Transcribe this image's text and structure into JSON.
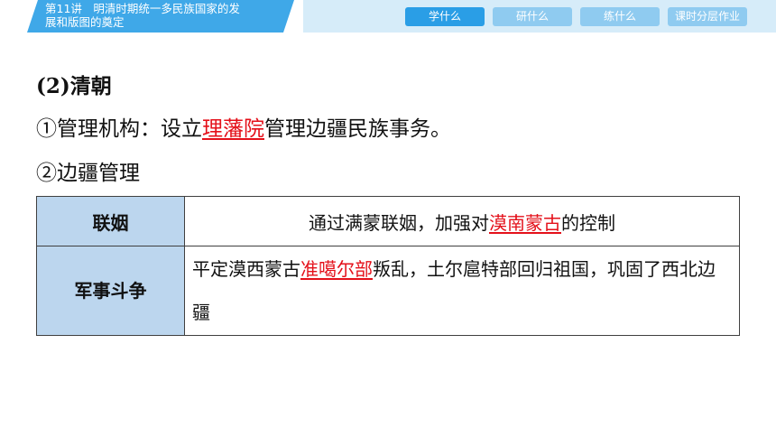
{
  "header": {
    "title": "第11讲　明清时期统一多民族国家的发\n展和版图的奠定",
    "tabs": [
      {
        "label": "学什么",
        "active": true
      },
      {
        "label": "研什么",
        "active": false
      },
      {
        "label": "练什么",
        "active": false
      },
      {
        "label": "课时分层作业",
        "active": false
      }
    ]
  },
  "content": {
    "heading": "(2)清朝",
    "point1": {
      "prefix": "①管理机构：设立",
      "highlight": "理藩院",
      "suffix": "管理边疆民族事务。"
    },
    "point2": "②边疆管理",
    "table": {
      "rows": [
        {
          "label": "联姻",
          "pre": "通过满蒙联姻，加强对",
          "highlight": "漠南蒙古",
          "post": "的控制"
        },
        {
          "label": "军事斗争",
          "pre": "平定漠西蒙古",
          "highlight": "准噶尔部",
          "post": "叛乱，土尔扈特部回归祖国，巩固了西北边疆"
        }
      ]
    }
  },
  "colors": {
    "accent": "#3fa8e8",
    "highlight": "#e4101a",
    "table_label_bg": "#bcd6ee"
  }
}
